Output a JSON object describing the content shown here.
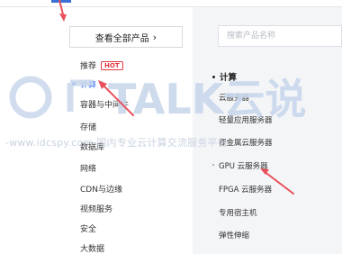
{
  "left": {
    "view_all_label": "查看全部产品",
    "view_all_icon": "chevron-right-icon",
    "categories": [
      {
        "label": "推荐",
        "badge": "HOT"
      },
      {
        "label": "计算",
        "active": true
      },
      {
        "label": "容器与中间件"
      },
      {
        "label": "存储"
      },
      {
        "label": "数据库"
      },
      {
        "label": "网络"
      },
      {
        "label": "CDN与边缘"
      },
      {
        "label": "视频服务"
      },
      {
        "label": "安全"
      },
      {
        "label": "大数据"
      }
    ]
  },
  "right": {
    "search_placeholder": "搜索产品名称",
    "section_title": "计算",
    "products": [
      {
        "label": "云服务器"
      },
      {
        "label": "轻量应用服务器"
      },
      {
        "label": "裸金属云服务器"
      },
      {
        "label": "GPU 云服务器",
        "highlight": true
      },
      {
        "label": "FPGA 云服务器"
      },
      {
        "label": "专用宿主机"
      },
      {
        "label": "弹性伸缩"
      }
    ]
  },
  "watermark": {
    "logo_text": "TALK云说",
    "url_text": "-www.idcspy.com-国内专业云计算交流服务平台-"
  },
  "colors": {
    "accent": "#2b6bf3",
    "hot": "#e0383e",
    "arrow": "#e8505b",
    "watermark": "#c9d3e0"
  }
}
